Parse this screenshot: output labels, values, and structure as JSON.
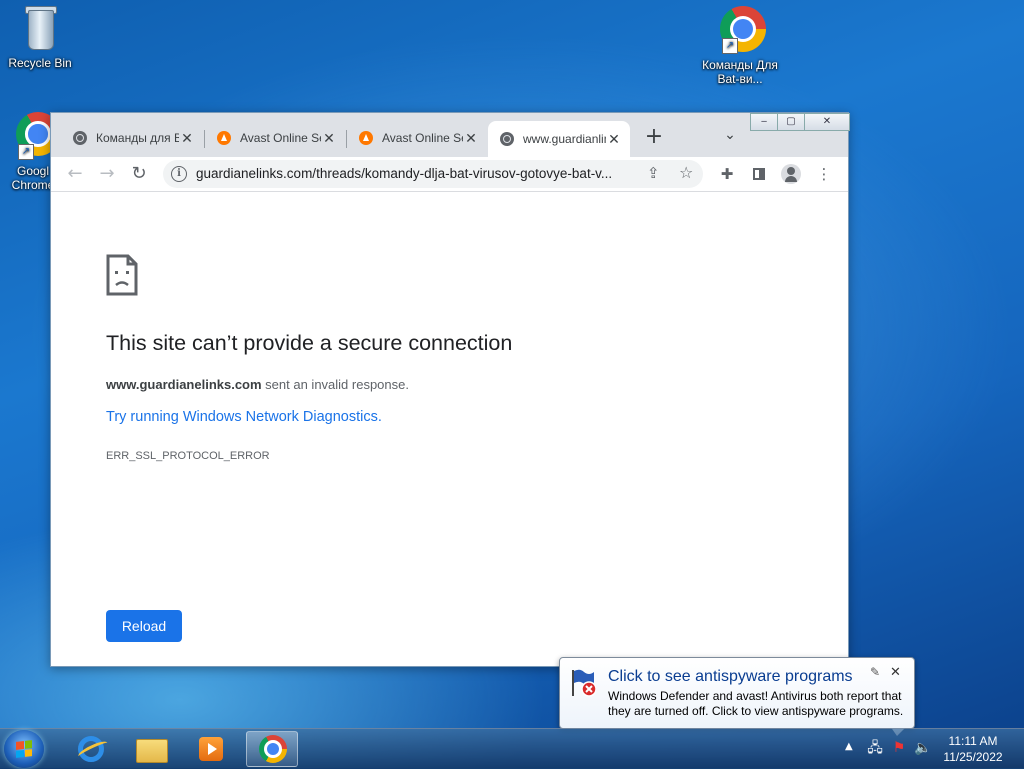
{
  "desktop": {
    "icons": [
      {
        "label": "Recycle Bin"
      },
      {
        "label": "Googl Chrome"
      },
      {
        "label": "Команды Для Bat-ви..."
      }
    ]
  },
  "browser": {
    "tabs": [
      {
        "title": "Команды для В",
        "icon": "globe-icon"
      },
      {
        "title": "Avast Online Se",
        "icon": "avast-icon"
      },
      {
        "title": "Avast Online Se",
        "icon": "avast-icon"
      },
      {
        "title": "www.guardianlinks",
        "icon": "globe-icon",
        "active": true
      }
    ],
    "new_tab": "+",
    "tab_search": "⌄",
    "window_controls": {
      "minimize": "‒",
      "maximize": "▢",
      "close": "✕"
    },
    "address_bar": {
      "url": "guardianelinks.com/threads/komandy-dlja-bat-virusov-gotovye-bat-v..."
    }
  },
  "error_page": {
    "title": "This site can’t provide a secure connection",
    "domain": "www.guardianelinks.com",
    "description": " sent an invalid response.",
    "diagnostics_link": "Try running Windows Network Diagnostics.",
    "error_code": "ERR_SSL_PROTOCOL_ERROR",
    "reload_label": "Reload"
  },
  "notification": {
    "title": "Click to see antispyware programs",
    "body": "Windows Defender and avast! Antivirus both report that they are turned off. Click to view antispyware programs."
  },
  "taskbar": {
    "time": "11:11 AM",
    "date": "11/25/2022"
  }
}
